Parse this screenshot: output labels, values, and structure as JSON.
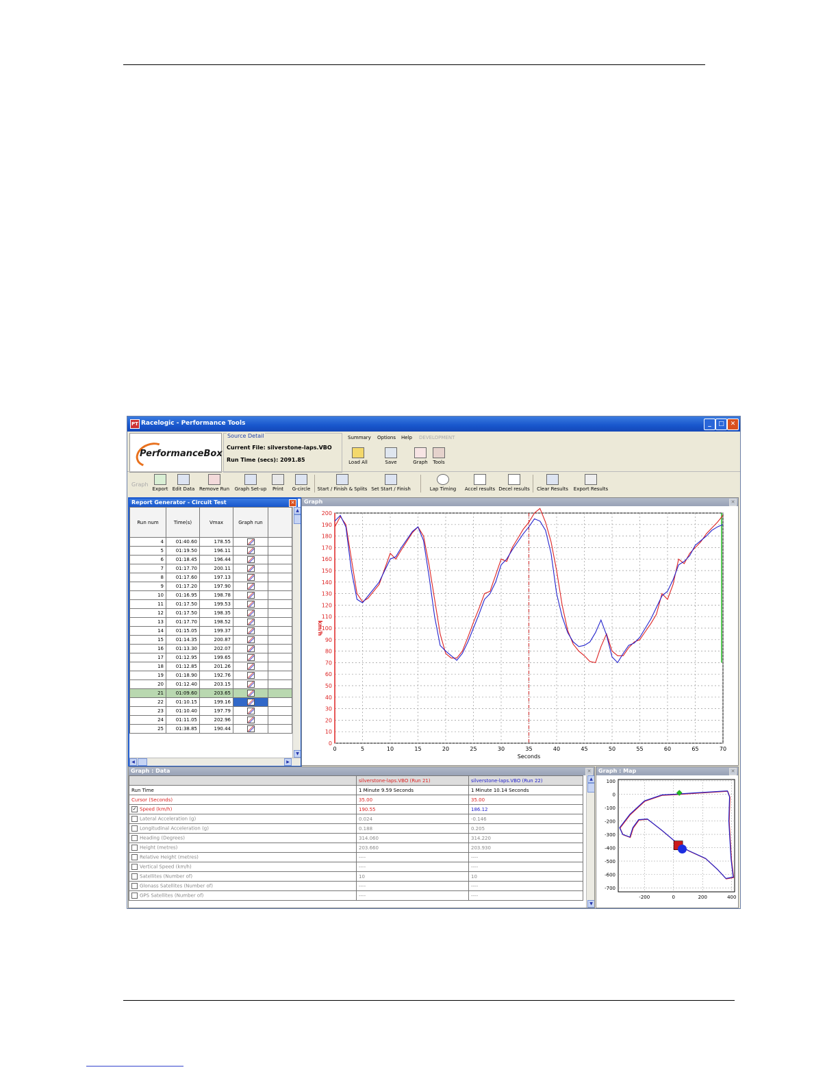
{
  "window": {
    "title": "Racelogic - Performance Tools",
    "icon_label": "PT"
  },
  "logo": {
    "text": "PerformanceBox"
  },
  "source": {
    "legend": "Source Detail",
    "current_file": "Current File:  silverstone-laps.VBO",
    "run_time": "Run Time (secs):  2091.85"
  },
  "menus": {
    "summary": "Summary",
    "options": "Options",
    "help": "Help",
    "development": "DEVELOPMENT"
  },
  "main_toolbar": {
    "load_all": "Load All",
    "save": "Save",
    "graph": "Graph",
    "tools": "Tools"
  },
  "ribbon": {
    "group": "Graph",
    "export": "Export",
    "edit_data": "Edit Data",
    "remove_run": "Remove Run",
    "graph_setup": "Graph Set-up",
    "print": "Print",
    "g_circle": "G-circle",
    "start_finish_splits": "Start / Finish & Splits",
    "set_start_finish": "Set Start / Finish",
    "lap_timing": "Lap Timing",
    "accel_results": "Accel results",
    "decel_results": "Decel results",
    "clear_results": "Clear Results",
    "export_results": "Export Results"
  },
  "report": {
    "title": "Report Generator - Circuit Test",
    "headers": [
      "Run num",
      "Time(s)",
      "Vmax",
      "Graph run"
    ],
    "rows": [
      [
        "4",
        "01:40.60",
        "178.55"
      ],
      [
        "5",
        "01:19.50",
        "196.11"
      ],
      [
        "6",
        "01:18.45",
        "196.44"
      ],
      [
        "7",
        "01:17.70",
        "200.11"
      ],
      [
        "8",
        "01:17.60",
        "197.13"
      ],
      [
        "9",
        "01:17.20",
        "197.90"
      ],
      [
        "10",
        "01:16.95",
        "198.78"
      ],
      [
        "11",
        "01:17.50",
        "199.53"
      ],
      [
        "12",
        "01:17.50",
        "198.35"
      ],
      [
        "13",
        "01:17.70",
        "198.52"
      ],
      [
        "14",
        "01:15.05",
        "199.37"
      ],
      [
        "15",
        "01:14.35",
        "200.87"
      ],
      [
        "16",
        "01:13.30",
        "202.07"
      ],
      [
        "17",
        "01:12.95",
        "199.65"
      ],
      [
        "18",
        "01:12.85",
        "201.26"
      ],
      [
        "19",
        "01:18.90",
        "192.76"
      ],
      [
        "20",
        "01:12.40",
        "203.15"
      ],
      [
        "21",
        "01:09.60",
        "203.65"
      ],
      [
        "22",
        "01:10.15",
        "199.16"
      ],
      [
        "23",
        "01:10.40",
        "197.79"
      ],
      [
        "24",
        "01:11.05",
        "202.96"
      ],
      [
        "25",
        "01:38.85",
        "190.44"
      ]
    ],
    "highlight_run": "21",
    "selected_run": "22"
  },
  "graph": {
    "title": "Graph"
  },
  "chart_data": {
    "type": "line",
    "xlabel": "Seconds",
    "ylabel": "km/h",
    "xlim": [
      0,
      70
    ],
    "ylim": [
      0,
      200
    ],
    "xticks": [
      0,
      5,
      10,
      15,
      20,
      25,
      30,
      35,
      40,
      45,
      50,
      55,
      60,
      65,
      70
    ],
    "yticks": [
      0,
      10,
      20,
      30,
      40,
      50,
      60,
      70,
      80,
      90,
      100,
      110,
      120,
      130,
      140,
      150,
      160,
      170,
      180,
      190,
      200
    ],
    "grid": true,
    "cursor_x": 35,
    "end_marker_x": 70,
    "series": [
      {
        "name": "silverstone-laps.VBO (Run 21)",
        "color": "#dd2222",
        "x": [
          0,
          1,
          2,
          3,
          4,
          5,
          6,
          8,
          10,
          11,
          12,
          14,
          15,
          16,
          17,
          18,
          19,
          20,
          21,
          22,
          23,
          24,
          25,
          26,
          27,
          28,
          29,
          30,
          31,
          32,
          33,
          34,
          35,
          36,
          37,
          38,
          39,
          40,
          41,
          42,
          43,
          44,
          45,
          46,
          47,
          48,
          49,
          50,
          51,
          52,
          53,
          54,
          55,
          56,
          57,
          58,
          59,
          60,
          61,
          62,
          63,
          64,
          65,
          66,
          67,
          68,
          69,
          70
        ],
        "y": [
          188,
          197,
          190,
          160,
          130,
          123,
          126,
          138,
          165,
          160,
          168,
          183,
          188,
          180,
          155,
          125,
          95,
          78,
          74,
          74,
          80,
          92,
          105,
          117,
          130,
          132,
          146,
          160,
          158,
          170,
          178,
          186,
          192,
          200,
          204,
          192,
          175,
          150,
          120,
          98,
          86,
          80,
          76,
          71,
          70,
          84,
          95,
          80,
          76,
          76,
          83,
          88,
          90,
          97,
          104,
          112,
          130,
          125,
          138,
          160,
          156,
          165,
          170,
          175,
          182,
          187,
          192,
          198
        ]
      },
      {
        "name": "silverstone-laps.VBO (Run 22)",
        "color": "#2222cc",
        "x": [
          0,
          1,
          2,
          3,
          4,
          5,
          6,
          8,
          10,
          11,
          12,
          14,
          15,
          16,
          17,
          18,
          19,
          20,
          21,
          22,
          23,
          24,
          25,
          26,
          27,
          28,
          29,
          30,
          31,
          32,
          33,
          34,
          35,
          36,
          37,
          38,
          39,
          40,
          41,
          42,
          43,
          44,
          45,
          46,
          47,
          48,
          49,
          50,
          51,
          52,
          53,
          54,
          55,
          56,
          57,
          58,
          59,
          60,
          61,
          62,
          63,
          64,
          65,
          66,
          67,
          68,
          69,
          70
        ],
        "y": [
          193,
          198,
          188,
          150,
          125,
          122,
          128,
          140,
          160,
          162,
          170,
          184,
          188,
          176,
          145,
          110,
          85,
          80,
          76,
          72,
          78,
          88,
          100,
          112,
          125,
          130,
          140,
          155,
          160,
          168,
          175,
          182,
          188,
          195,
          193,
          185,
          165,
          130,
          110,
          96,
          88,
          84,
          85,
          88,
          96,
          107,
          94,
          75,
          70,
          78,
          85,
          87,
          92,
          100,
          108,
          118,
          128,
          132,
          142,
          155,
          158,
          163,
          172,
          176,
          180,
          185,
          188,
          190
        ]
      }
    ]
  },
  "data_panel": {
    "title": "Graph : Data",
    "col1": "silverstone-laps.VBO (Run 21)",
    "col2": "silverstone-laps.VBO (Run 22)",
    "rows": [
      {
        "label": "Run Time",
        "v1": "1 Minute 9.59 Seconds",
        "v2": "1 Minute 10.14 Seconds",
        "style": "normal",
        "check": ""
      },
      {
        "label": "Cursor (Seconds)",
        "v1": "35.00",
        "v2": "35.00",
        "style": "red",
        "check": ""
      },
      {
        "label": "Speed (km/h)",
        "v1": "190.55",
        "v2": "186.12",
        "style": "speed",
        "check": "✓"
      },
      {
        "label": "Lateral Acceleration (g)",
        "v1": "0.024",
        "v2": "-0.146",
        "style": "grey",
        "check": ""
      },
      {
        "label": "Longitudinal Acceleration (g)",
        "v1": "0.188",
        "v2": "0.205",
        "style": "grey",
        "check": ""
      },
      {
        "label": "Heading (Degrees)",
        "v1": "314.060",
        "v2": "314.220",
        "style": "grey",
        "check": ""
      },
      {
        "label": "Height (metres)",
        "v1": "203.660",
        "v2": "203.930",
        "style": "grey",
        "check": ""
      },
      {
        "label": "Relative Height (metres)",
        "v1": "----",
        "v2": "----",
        "style": "grey",
        "check": ""
      },
      {
        "label": "Vertical Speed (km/h)",
        "v1": "----",
        "v2": "----",
        "style": "grey",
        "check": ""
      },
      {
        "label": "Satellites (Number of)",
        "v1": "10",
        "v2": "10",
        "style": "grey",
        "check": ""
      },
      {
        "label": "Glonass Satellites (Number of)",
        "v1": "----",
        "v2": "----",
        "style": "grey",
        "check": ""
      },
      {
        "label": "GPS Satellites (Number of)",
        "v1": "----",
        "v2": "----",
        "style": "grey",
        "check": ""
      }
    ]
  },
  "map_panel": {
    "title": "Graph : Map",
    "xticks": [
      -200,
      0,
      200,
      400
    ],
    "yticks": [
      100,
      0,
      -100,
      -200,
      -300,
      -400,
      -500,
      -600,
      -700
    ],
    "xlim": [
      -380,
      420
    ],
    "ylim": [
      -730,
      110
    ]
  }
}
